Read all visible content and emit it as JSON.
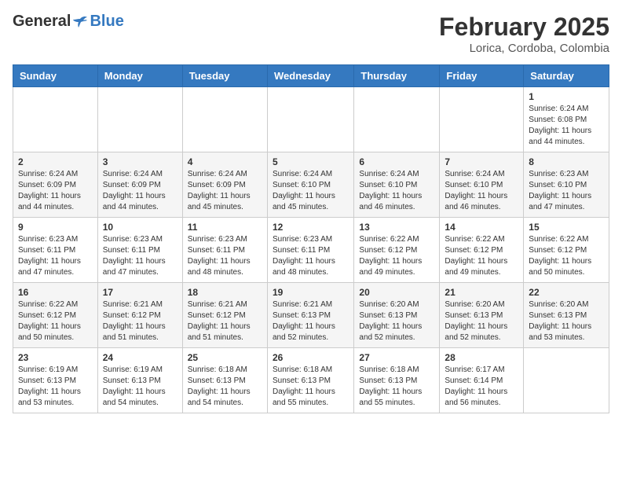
{
  "header": {
    "logo_general": "General",
    "logo_blue": "Blue",
    "month_title": "February 2025",
    "location": "Lorica, Cordoba, Colombia"
  },
  "weekdays": [
    "Sunday",
    "Monday",
    "Tuesday",
    "Wednesday",
    "Thursday",
    "Friday",
    "Saturday"
  ],
  "weeks": [
    [
      {
        "day": "",
        "info": ""
      },
      {
        "day": "",
        "info": ""
      },
      {
        "day": "",
        "info": ""
      },
      {
        "day": "",
        "info": ""
      },
      {
        "day": "",
        "info": ""
      },
      {
        "day": "",
        "info": ""
      },
      {
        "day": "1",
        "info": "Sunrise: 6:24 AM\nSunset: 6:08 PM\nDaylight: 11 hours and 44 minutes."
      }
    ],
    [
      {
        "day": "2",
        "info": "Sunrise: 6:24 AM\nSunset: 6:09 PM\nDaylight: 11 hours and 44 minutes."
      },
      {
        "day": "3",
        "info": "Sunrise: 6:24 AM\nSunset: 6:09 PM\nDaylight: 11 hours and 44 minutes."
      },
      {
        "day": "4",
        "info": "Sunrise: 6:24 AM\nSunset: 6:09 PM\nDaylight: 11 hours and 45 minutes."
      },
      {
        "day": "5",
        "info": "Sunrise: 6:24 AM\nSunset: 6:10 PM\nDaylight: 11 hours and 45 minutes."
      },
      {
        "day": "6",
        "info": "Sunrise: 6:24 AM\nSunset: 6:10 PM\nDaylight: 11 hours and 46 minutes."
      },
      {
        "day": "7",
        "info": "Sunrise: 6:24 AM\nSunset: 6:10 PM\nDaylight: 11 hours and 46 minutes."
      },
      {
        "day": "8",
        "info": "Sunrise: 6:23 AM\nSunset: 6:10 PM\nDaylight: 11 hours and 47 minutes."
      }
    ],
    [
      {
        "day": "9",
        "info": "Sunrise: 6:23 AM\nSunset: 6:11 PM\nDaylight: 11 hours and 47 minutes."
      },
      {
        "day": "10",
        "info": "Sunrise: 6:23 AM\nSunset: 6:11 PM\nDaylight: 11 hours and 47 minutes."
      },
      {
        "day": "11",
        "info": "Sunrise: 6:23 AM\nSunset: 6:11 PM\nDaylight: 11 hours and 48 minutes."
      },
      {
        "day": "12",
        "info": "Sunrise: 6:23 AM\nSunset: 6:11 PM\nDaylight: 11 hours and 48 minutes."
      },
      {
        "day": "13",
        "info": "Sunrise: 6:22 AM\nSunset: 6:12 PM\nDaylight: 11 hours and 49 minutes."
      },
      {
        "day": "14",
        "info": "Sunrise: 6:22 AM\nSunset: 6:12 PM\nDaylight: 11 hours and 49 minutes."
      },
      {
        "day": "15",
        "info": "Sunrise: 6:22 AM\nSunset: 6:12 PM\nDaylight: 11 hours and 50 minutes."
      }
    ],
    [
      {
        "day": "16",
        "info": "Sunrise: 6:22 AM\nSunset: 6:12 PM\nDaylight: 11 hours and 50 minutes."
      },
      {
        "day": "17",
        "info": "Sunrise: 6:21 AM\nSunset: 6:12 PM\nDaylight: 11 hours and 51 minutes."
      },
      {
        "day": "18",
        "info": "Sunrise: 6:21 AM\nSunset: 6:12 PM\nDaylight: 11 hours and 51 minutes."
      },
      {
        "day": "19",
        "info": "Sunrise: 6:21 AM\nSunset: 6:13 PM\nDaylight: 11 hours and 52 minutes."
      },
      {
        "day": "20",
        "info": "Sunrise: 6:20 AM\nSunset: 6:13 PM\nDaylight: 11 hours and 52 minutes."
      },
      {
        "day": "21",
        "info": "Sunrise: 6:20 AM\nSunset: 6:13 PM\nDaylight: 11 hours and 52 minutes."
      },
      {
        "day": "22",
        "info": "Sunrise: 6:20 AM\nSunset: 6:13 PM\nDaylight: 11 hours and 53 minutes."
      }
    ],
    [
      {
        "day": "23",
        "info": "Sunrise: 6:19 AM\nSunset: 6:13 PM\nDaylight: 11 hours and 53 minutes."
      },
      {
        "day": "24",
        "info": "Sunrise: 6:19 AM\nSunset: 6:13 PM\nDaylight: 11 hours and 54 minutes."
      },
      {
        "day": "25",
        "info": "Sunrise: 6:18 AM\nSunset: 6:13 PM\nDaylight: 11 hours and 54 minutes."
      },
      {
        "day": "26",
        "info": "Sunrise: 6:18 AM\nSunset: 6:13 PM\nDaylight: 11 hours and 55 minutes."
      },
      {
        "day": "27",
        "info": "Sunrise: 6:18 AM\nSunset: 6:13 PM\nDaylight: 11 hours and 55 minutes."
      },
      {
        "day": "28",
        "info": "Sunrise: 6:17 AM\nSunset: 6:14 PM\nDaylight: 11 hours and 56 minutes."
      },
      {
        "day": "",
        "info": ""
      }
    ]
  ]
}
